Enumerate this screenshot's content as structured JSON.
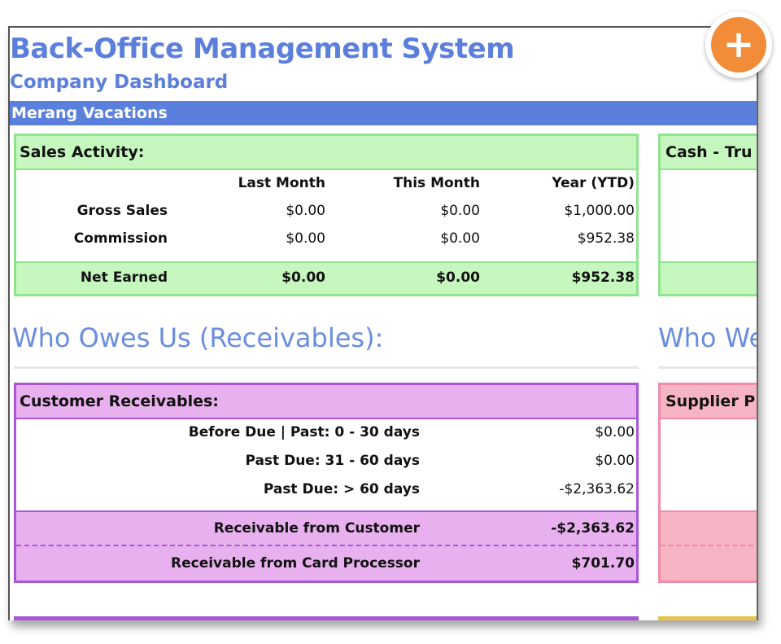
{
  "header": {
    "title": "Back-Office Management System",
    "subtitle": "Company Dashboard",
    "company": "Merang Vacations"
  },
  "sales": {
    "heading": "Sales Activity:",
    "columns": [
      "Last Month",
      "This Month",
      "Year (YTD)"
    ],
    "rows": [
      {
        "label": "Gross Sales",
        "values": [
          "$0.00",
          "$0.00",
          "$1,000.00"
        ]
      },
      {
        "label": "Commission",
        "values": [
          "$0.00",
          "$0.00",
          "$952.38"
        ]
      }
    ],
    "total": {
      "label": "Net Earned",
      "values": [
        "$0.00",
        "$0.00",
        "$952.38"
      ]
    }
  },
  "cash": {
    "heading": "Cash - Tru"
  },
  "receivables": {
    "section_title": "Who Owes Us (Receivables):",
    "heading": "Customer Receivables:",
    "rows": [
      {
        "label": "Before Due | Past: 0 - 30 days",
        "value": "$0.00"
      },
      {
        "label": "Past Due: 31 - 60 days",
        "value": "$0.00"
      },
      {
        "label": "Past Due: > 60 days",
        "value": "-$2,363.62"
      }
    ],
    "totals": [
      {
        "label": "Receivable from Customer",
        "value": "-$2,363.62"
      },
      {
        "label": "Receivable from Card Processor",
        "value": "$701.70"
      }
    ]
  },
  "payables": {
    "section_title": "Who We",
    "heading": "Supplier P"
  },
  "fab": {
    "icon": "plus-icon",
    "symbol": "+",
    "color": "#f28c38"
  },
  "colors": {
    "brand_blue": "#5b7fdb",
    "sales_green": "#c6f7be",
    "receivable_purple": "#e8b0ee",
    "payable_pink": "#f7b4c4"
  }
}
